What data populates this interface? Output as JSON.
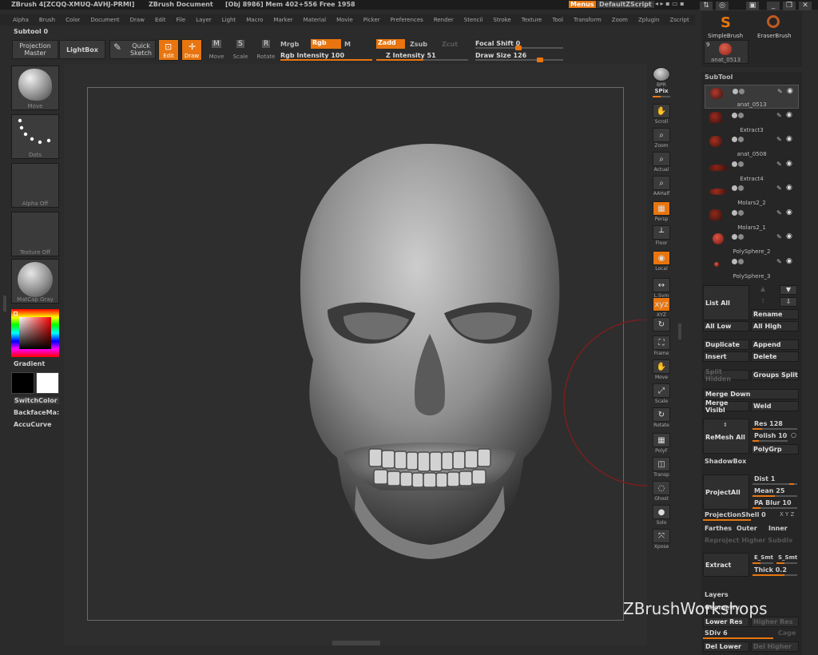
{
  "titlebar": {
    "app": "ZBrush 4[ZCQQ-XMUQ-AVHJ-PRMI]",
    "doc": "ZBrush Document",
    "obj": "[Obj 8986] Mem 402+556 Free 1958",
    "menus": "Menus",
    "script": "DefaultZScript"
  },
  "menu": [
    "Alpha",
    "Brush",
    "Color",
    "Document",
    "Draw",
    "Edit",
    "File",
    "Layer",
    "Light",
    "Macro",
    "Marker",
    "Material",
    "Movie",
    "Picker",
    "Preferences",
    "Render",
    "Stencil",
    "Stroke",
    "Texture",
    "Tool",
    "Transform",
    "Zoom",
    "Zplugin",
    "Zscript"
  ],
  "toolbar": {
    "subtool": "Subtool 0",
    "projection": "Projection\nMaster",
    "lightbox": "LightBox",
    "quick": "Quick\nSketch",
    "edit": "Edit",
    "draw": "Draw",
    "move": "Move",
    "scale": "Scale",
    "rotate": "Rotate",
    "mrgb": "Mrgb",
    "rgb": "Rgb",
    "m": "M",
    "rgb_intensity": "Rgb Intensity 100",
    "zadd": "Zadd",
    "zsub": "Zsub",
    "zcut": "Zcut",
    "z_intensity": "Z Intensity 51",
    "focal": "Focal Shift 0",
    "draw_size": "Draw Size 126",
    "rgb_val": 1.0,
    "z_val": 0.51,
    "focal_val": 0.0,
    "size_val": 0.5
  },
  "left": {
    "move": "Move",
    "dots": "Dots",
    "alpha": "Alpha Off",
    "texture": "Texture Off",
    "matcap": "MatCap Gray",
    "gradient": "Gradient",
    "switch": "SwitchColor",
    "backface": "BackfaceMa:",
    "accucurve": "AccuCurve"
  },
  "right_tools": [
    {
      "l": "BPR",
      "ic": "●",
      "on": false
    },
    {
      "l": "SPix",
      "ic": "",
      "on": false
    },
    {
      "l": "Scroll",
      "ic": "✋",
      "on": false
    },
    {
      "l": "Zoom",
      "ic": "⌕",
      "on": false
    },
    {
      "l": "Actual",
      "ic": "⌕",
      "on": false
    },
    {
      "l": "AAHalf",
      "ic": "⌕",
      "on": false
    },
    {
      "l": "Persp",
      "ic": "▦",
      "on": true
    },
    {
      "l": "Floor",
      "ic": "┴",
      "on": false
    },
    {
      "l": "Local",
      "ic": "◉",
      "on": true
    },
    {
      "l": "L.Sym",
      "ic": "↔",
      "on": false
    },
    {
      "l": "XYZ",
      "ic": "xyz",
      "on": true
    },
    {
      "l": "",
      "ic": "↻",
      "on": false
    },
    {
      "l": "Frame",
      "ic": "⛶",
      "on": false
    },
    {
      "l": "Move",
      "ic": "✋",
      "on": false
    },
    {
      "l": "Scale",
      "ic": "⤢",
      "on": false
    },
    {
      "l": "Rotate",
      "ic": "↻",
      "on": false
    },
    {
      "l": "PolyF",
      "ic": "▦",
      "on": false
    },
    {
      "l": "Transp",
      "ic": "◫",
      "on": false
    },
    {
      "l": "Ghost",
      "ic": "◌",
      "on": false
    },
    {
      "l": "Solo",
      "ic": "●",
      "on": false
    },
    {
      "l": "Xpose",
      "ic": "⤧",
      "on": false
    }
  ],
  "brushes": {
    "simple": "SimpleBrush",
    "eraser": "EraserBrush",
    "tool_count": "9",
    "tool_name": "anat_0513"
  },
  "subtool": {
    "header": "SubTool",
    "items": [
      "anat_0513",
      "Extract3",
      "anat_0508",
      "Extract4",
      "Molars2_2",
      "Molars2_1",
      "PolySphere_2",
      "PolySphere_3"
    ]
  },
  "panel": {
    "list_all": "List All",
    "rename": "Rename",
    "all_low": "All Low",
    "all_high": "All High",
    "duplicate": "Duplicate",
    "append": "Append",
    "insert": "Insert",
    "delete": "Delete",
    "split_hidden": "Split Hidden",
    "groups_split": "Groups Split",
    "merge_down": "Merge Down",
    "merge_visible": "Merge Visibl",
    "weld": "Weld",
    "remesh_all": "ReMesh All",
    "res": "Res 128",
    "polish": "Polish 10",
    "polygrp": "PolyGrp",
    "shadowbox": "ShadowBox",
    "projectall": "ProjectAll",
    "dist": "Dist 1",
    "mean": "Mean 25",
    "pa_blur": "PA Blur 10",
    "projshell": "ProjectionShell 0",
    "xyz": "X Y Z",
    "farthes": "Farthes",
    "outer": "Outer",
    "inner": "Inner",
    "reproject": "Reproject Higher Subdiv",
    "extract": "Extract",
    "e_smt": "E_Smt",
    "s_smt": "S_Smt",
    "thick": "Thick 0.2",
    "layers": "Layers",
    "geometry": "Geometry",
    "lower_res": "Lower Res",
    "higher_res": "Higher Res",
    "sdiv": "SDiv 6",
    "cage": "Cage",
    "del_lower": "Del Lower",
    "del_higher": "Del Higher"
  },
  "watermark": "ZBrushWorkshops"
}
